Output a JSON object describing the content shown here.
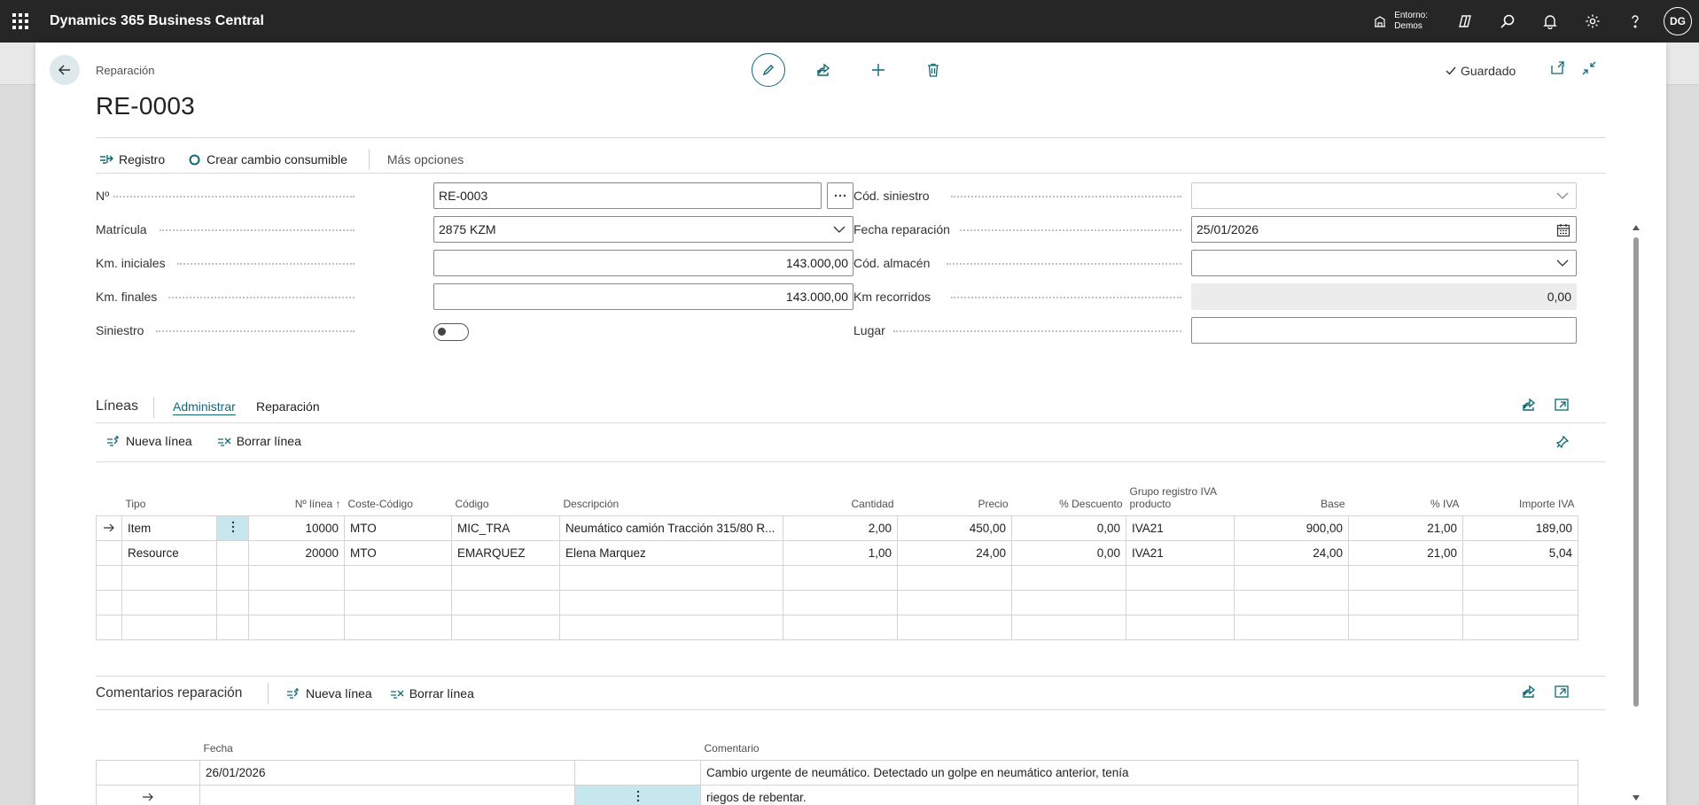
{
  "topbar": {
    "app_title": "Dynamics 365 Business Central",
    "environment_line1": "Entorno:",
    "environment_line2": "Demos",
    "avatar_initials": "DG"
  },
  "page": {
    "caption": "Reparación",
    "record_title": "RE-0003",
    "saved_label": "Guardado"
  },
  "actions": {
    "registro": "Registro",
    "crear_cambio": "Crear cambio consumible",
    "mas_opciones": "Más opciones"
  },
  "form": {
    "left": [
      {
        "label": "Nº",
        "value": "RE-0003"
      },
      {
        "label": "Matrícula",
        "value": "2875 KZM"
      },
      {
        "label": "Km. iniciales",
        "value": "143.000,00"
      },
      {
        "label": "Km. finales",
        "value": "143.000,00"
      },
      {
        "label": "Siniestro",
        "value": ""
      }
    ],
    "right": [
      {
        "label": "Cód. siniestro",
        "value": ""
      },
      {
        "label": "Fecha reparación",
        "value": "25/01/2026"
      },
      {
        "label": "Cód. almacén",
        "value": ""
      },
      {
        "label": "Km recorridos",
        "value": "0,00"
      },
      {
        "label": "Lugar",
        "value": ""
      }
    ]
  },
  "lines": {
    "title": "Líneas",
    "tabs": [
      "Administrar",
      "Reparación"
    ],
    "nueva_linea": "Nueva línea",
    "borrar_linea": "Borrar línea",
    "columns": [
      "Tipo",
      "Nº línea ↑",
      "Coste-Código",
      "Código",
      "Descripción",
      "Cantidad",
      "Precio",
      "% Descuento",
      "Grupo registro IVA producto",
      "Base",
      "% IVA",
      "Importe IVA"
    ],
    "rows": [
      [
        "Item",
        "10000",
        "MTO",
        "MIC_TRA",
        "Neumático camión Tracción 315/80 R...",
        "2,00",
        "450,00",
        "0,00",
        "IVA21",
        "900,00",
        "21,00",
        "189,00"
      ],
      [
        "Resource",
        "20000",
        "MTO",
        "EMARQUEZ",
        "Elena Marquez",
        "1,00",
        "24,00",
        "0,00",
        "IVA21",
        "24,00",
        "21,00",
        "5,04"
      ]
    ]
  },
  "comments": {
    "title": "Comentarios reparación",
    "nueva_linea": "Nueva línea",
    "borrar_linea": "Borrar línea",
    "columns": [
      "Fecha",
      "Comentario"
    ],
    "rows": [
      [
        "26/01/2026",
        "Cambio urgente de neumático. Detectado un golpe en neumático anterior, tenía"
      ],
      [
        "",
        "riegos de rebentar."
      ]
    ]
  }
}
